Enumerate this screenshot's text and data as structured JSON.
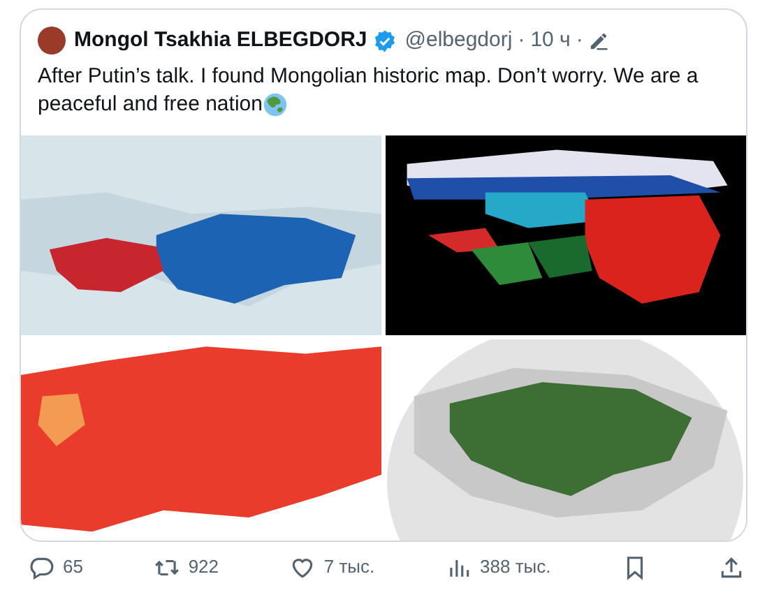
{
  "tweet": {
    "author": "Mongol Tsakhia ELBEGDORJ",
    "verified": true,
    "handle": "@elbegdorj",
    "separator": "·",
    "time": "10 ч",
    "separator_2": "·",
    "text_lines": [
      "After Putin’s talk. I found Mongolian historic map. Don’t worry. We are a",
      "peaceful and free nation"
    ],
    "media": [
      {
        "kind": "roman"
      },
      {
        "kind": "flags"
      },
      {
        "kind": "red"
      },
      {
        "kind": "globe"
      }
    ]
  },
  "actions": [
    {
      "kind": "reply",
      "count": "65"
    },
    {
      "kind": "repost",
      "count": "922"
    },
    {
      "kind": "like",
      "count": "7 тыс."
    },
    {
      "kind": "views",
      "count": "388 тыс."
    },
    {
      "kind": "bookmark"
    },
    {
      "kind": "share"
    }
  ]
}
